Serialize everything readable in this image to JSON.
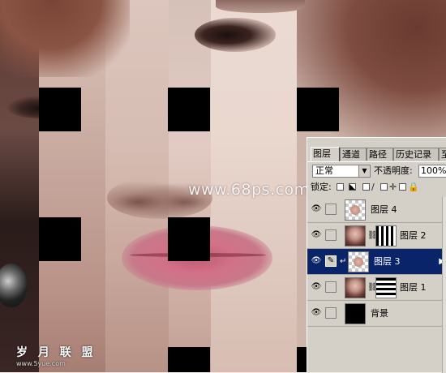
{
  "canvas": {
    "watermark_site": "www.68ps.com",
    "watermark_brand": "岁 月 联 盟",
    "watermark_url": "www.5yue.com"
  },
  "layers_panel": {
    "tabs": [
      {
        "label": "图层",
        "active": true
      },
      {
        "label": "通道",
        "active": false
      },
      {
        "label": "路径",
        "active": false
      },
      {
        "label": "历史记录",
        "active": false
      },
      {
        "label": "至",
        "active": false
      }
    ],
    "blend_mode": "正常",
    "opacity_label": "不透明度:",
    "opacity_value": "100%",
    "lock_label": "锁定:",
    "lock_icons": [
      "lock-transparent-icon",
      "lock-image-icon",
      "brush-icon",
      "move-icon",
      "lock-all-icon"
    ],
    "layers": [
      {
        "name": "图层 4",
        "visible": true,
        "selected": false,
        "thumbnail": "checker-face",
        "mask": "none"
      },
      {
        "name": "图层 2",
        "visible": true,
        "selected": false,
        "thumbnail": "face",
        "mask": "vertical-stripes"
      },
      {
        "name": "图层 3",
        "visible": true,
        "selected": true,
        "thumbnail": "checker-face",
        "mask": "none"
      },
      {
        "name": "图层 1",
        "visible": true,
        "selected": false,
        "thumbnail": "face",
        "mask": "horizontal-stripes"
      },
      {
        "name": "背景",
        "visible": true,
        "selected": false,
        "thumbnail": "black",
        "mask": "none"
      }
    ]
  },
  "colors": {
    "selection": "#0a246a",
    "panel_bg": "#d4d0c8"
  }
}
